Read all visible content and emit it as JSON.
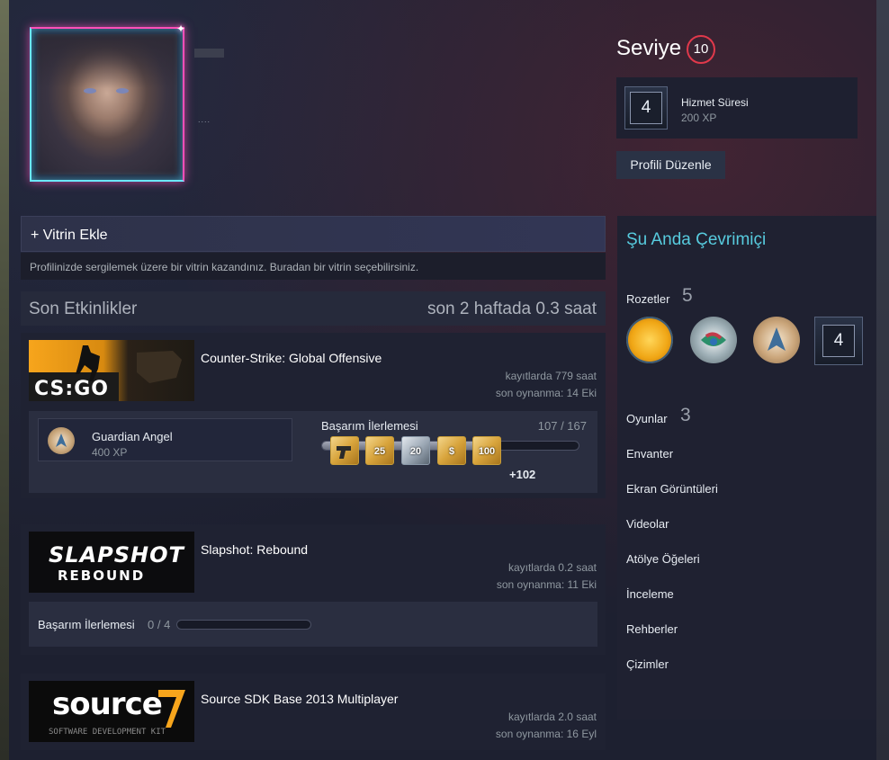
{
  "profile": {
    "name_dots": "....",
    "level_label": "Seviye",
    "level": "10",
    "service": {
      "name": "Hizmet Süresi",
      "xp": "200 XP",
      "icon_number": "4"
    },
    "edit_button": "Profili Düzenle"
  },
  "showcase": {
    "title": "+ Vitrin Ekle",
    "description": "Profilinizde sergilemek üzere bir vitrin kazandınız. Buradan bir vitrin seçebilirsiniz."
  },
  "recent": {
    "title": "Son Etkinlikler",
    "hours": "son 2 haftada 0.3 saat",
    "games": [
      {
        "banner_text": "CS:GO",
        "name": "Counter-Strike: Global Offensive",
        "hours": "kayıtlarda 779 saat",
        "last": "son oynanma: 14 Eki",
        "achievement": {
          "name": "Guardian Angel",
          "xp": "400 XP"
        },
        "progress_label": "Başarım İlerlemesi",
        "progress_count": "107 / 167",
        "progress_fraction": 0.641,
        "mini_icons": [
          "",
          "25",
          "20",
          "$",
          "100"
        ],
        "more": "+102"
      },
      {
        "banner_text": "SLAPSHOT",
        "banner_sub": "REBOUND",
        "name": "Slapshot: Rebound",
        "hours": "kayıtlarda 0.2 saat",
        "last": "son oynanma: 11 Eki",
        "progress_label": "Başarım İlerlemesi",
        "progress_count": "0 / 4",
        "progress_fraction": 0
      },
      {
        "banner_text": "source",
        "banner_sub": "SOFTWARE DEVELOPMENT KIT",
        "name": "Source SDK Base 2013 Multiplayer",
        "hours": "kayıtlarda 2.0 saat",
        "last": "son oynanma: 16 Eyl"
      }
    ]
  },
  "sidebar": {
    "status": "Şu Anda Çevrimiçi",
    "badges_label": "Rozetler",
    "badges_count": "5",
    "badge_number": "4",
    "games_label": "Oyunlar",
    "games_count": "3",
    "links": [
      "Envanter",
      "Ekran Görüntüleri",
      "Videolar",
      "Atölye Öğeleri",
      "İnceleme",
      "Rehberler",
      "Çizimler"
    ]
  },
  "colors": {
    "online": "#57cbde",
    "level_ring": "#e0394b",
    "background": "#1d2030"
  }
}
